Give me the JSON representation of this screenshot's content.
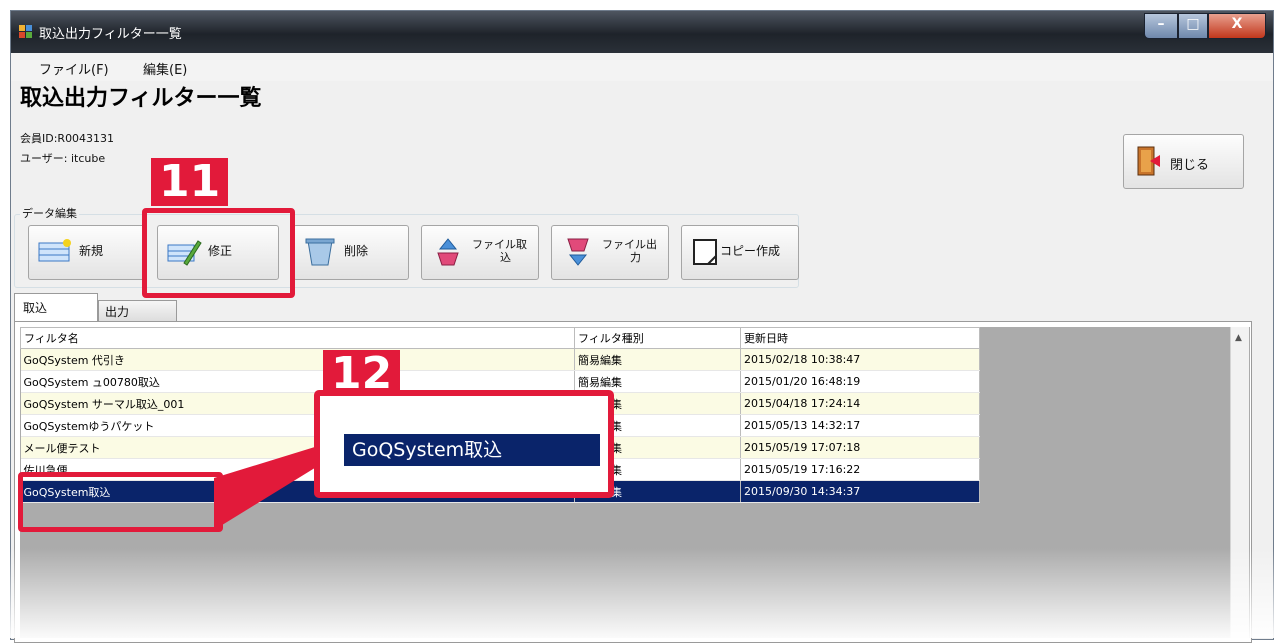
{
  "window": {
    "title": "取込出力フィルター一覧"
  },
  "menu": {
    "items": [
      "ファイル(F)",
      "編集(E)"
    ]
  },
  "page_title": "取込出力フィルター一覧",
  "member_id": "会員ID:R0043131",
  "user": "ユーザー: itcube",
  "close_button": {
    "label": "閉じる",
    "icon": "exit-door-icon"
  },
  "data_edit": {
    "group_label": "データ編集",
    "buttons": {
      "new": {
        "label": "新規",
        "icon": "new-filter-icon"
      },
      "edit": {
        "label": "修正",
        "icon": "edit-pencil-icon"
      },
      "delete": {
        "label": "削除",
        "icon": "trash-icon"
      },
      "file_import": {
        "line1": "ファイル取",
        "line2": "込",
        "icon": "file-import-icon"
      },
      "file_export": {
        "line1": "ファイル出",
        "line2": "力",
        "icon": "file-export-icon"
      },
      "copy": {
        "label": "コピー作成",
        "icon": "copy-icon"
      }
    }
  },
  "tabs": {
    "import": "取込",
    "export": "出力"
  },
  "table": {
    "headers": [
      "フィルタ名",
      "フィルタ種別",
      "更新日時"
    ],
    "rows": [
      {
        "name": "GoQSystem 代引き",
        "type": "簡易編集",
        "updated": "2015/02/18 10:38:47"
      },
      {
        "name": "GoQSystem ュ00780取込",
        "type": "簡易編集",
        "updated": "2015/01/20 16:48:19"
      },
      {
        "name": "GoQSystem サーマル取込_001",
        "type": "簡易編集",
        "updated": "2015/04/18 17:24:14"
      },
      {
        "name": "GoQSystemゆうパケット",
        "type": "簡易編集",
        "updated": "2015/05/13 14:32:17"
      },
      {
        "name": "メール便テスト",
        "type": "簡易編集",
        "updated": "2015/05/19 17:07:18"
      },
      {
        "name": "佐川急便",
        "type": "簡易編集",
        "updated": "2015/05/19 17:16:22"
      },
      {
        "name": "GoQSystem取込",
        "type": "簡易編集",
        "updated": "2015/09/30 14:34:37"
      }
    ]
  },
  "annotations": {
    "step11": "11",
    "step12": "12",
    "zoom_text": "GoQSystem取込"
  },
  "colors": {
    "callout": "#e21a3a",
    "selection": "#0a246a",
    "row_alt": "#fbfbe4"
  }
}
